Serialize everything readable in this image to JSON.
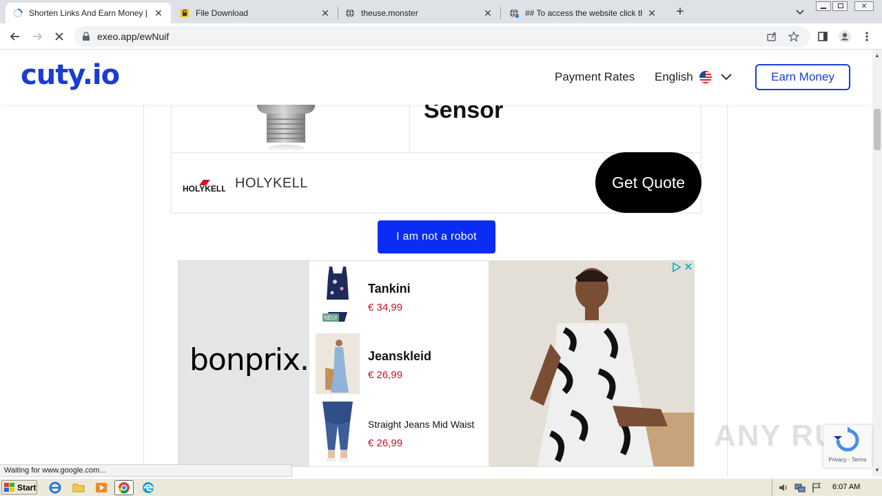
{
  "browser": {
    "tabs": [
      {
        "title": "Shorten Links And Earn Money | cuty.io",
        "active": true
      },
      {
        "title": "File Download",
        "active": false
      },
      {
        "title": "theuse.monster",
        "active": false
      },
      {
        "title": "## To access the website click the \"Allow\"",
        "active": false
      }
    ],
    "url": "exeo.app/ewNuif",
    "status_text": "Waiting for www.google.com..."
  },
  "site": {
    "logo": "cuty.io",
    "nav_payment": "Payment Rates",
    "nav_language": "English",
    "earn_button": "Earn Money"
  },
  "product_card": {
    "title": "Sensor",
    "brand_logo_text": "HOLYKELL",
    "brand_name": "HOLYKELL",
    "quote_button": "Get Quote"
  },
  "robot_button": "I am not a robot",
  "ad": {
    "brand": "bonprix.",
    "badge": "NEU!",
    "items": [
      {
        "name": "Tankini",
        "price": "€ 34,99"
      },
      {
        "name": "Jeanskleid",
        "price": "€ 26,99"
      },
      {
        "name": "Straight Jeans Mid Waist",
        "price": "€ 26,99"
      }
    ]
  },
  "recaptcha": {
    "links": "Privacy - Terms"
  },
  "watermark": "ANY RUN",
  "taskbar": {
    "start_label": "Start",
    "clock": "6:07 AM"
  },
  "colors": {
    "brand_blue": "#1a3bd6",
    "robot_button": "#0a2cf5",
    "price_red": "#c8102e"
  }
}
